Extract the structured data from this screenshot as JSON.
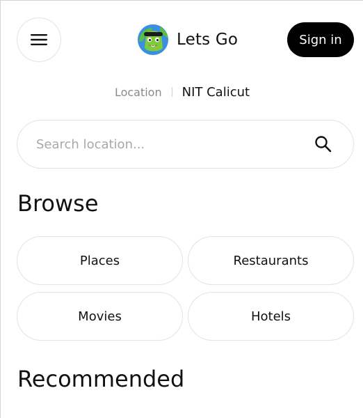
{
  "header": {
    "menu_icon": "hamburger-menu-icon",
    "brand_name": "Lets Go",
    "brand_logo": "smiling-globe-mascot-logo",
    "sign_in_label": "Sign in"
  },
  "location": {
    "label": "Location",
    "value": "NIT Calicut"
  },
  "search": {
    "placeholder": "Search location...",
    "value": "",
    "icon": "search-icon"
  },
  "browse": {
    "title": "Browse",
    "items": [
      {
        "label": "Places"
      },
      {
        "label": "Restaurants"
      },
      {
        "label": "Movies"
      },
      {
        "label": "Hotels"
      }
    ]
  },
  "recommended": {
    "title": "Recommended"
  },
  "colors": {
    "accent": "#000000",
    "border": "#e3e3e3",
    "muted_text": "#8a8a8a",
    "placeholder": "#a8a8a8",
    "logo_blue": "#3b8fe0",
    "logo_green": "#7ccc3c"
  }
}
